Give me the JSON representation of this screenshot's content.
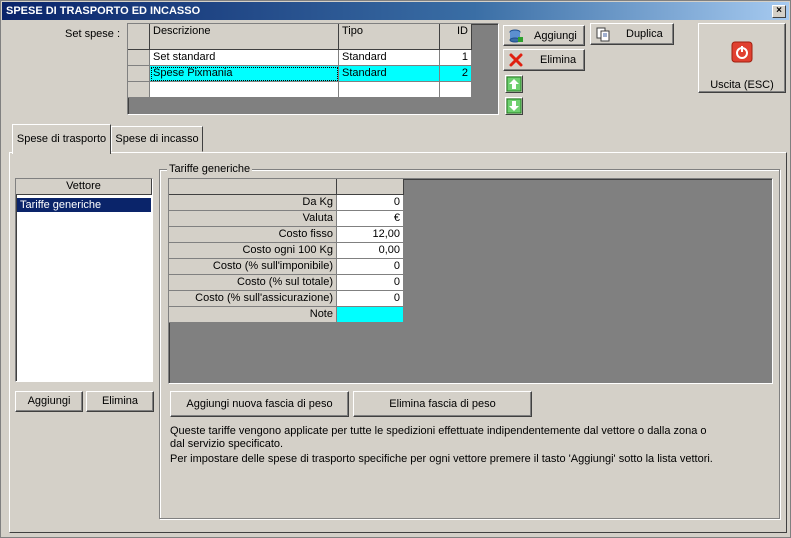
{
  "window": {
    "title": "SPESE DI TRASPORTO ED INCASSO",
    "close_glyph": "×"
  },
  "set_spese": {
    "label": "Set spese :",
    "columns": [
      "Descrizione",
      "Tipo",
      "ID"
    ],
    "rows": [
      {
        "descrizione": "Set standard",
        "tipo": "Standard",
        "id": "1"
      },
      {
        "descrizione": "Spese Pixmania",
        "tipo": "Standard",
        "id": "2"
      }
    ]
  },
  "toolbar": {
    "aggiungi": "Aggiungi",
    "elimina": "Elimina",
    "duplica": "Duplica",
    "uscita": "Uscita (ESC)"
  },
  "tabs": [
    {
      "label": "Spese di trasporto"
    },
    {
      "label": "Spese di incasso"
    }
  ],
  "vettore": {
    "header": "Vettore",
    "items": [
      "Tariffe generiche"
    ],
    "aggiungi": "Aggiungi",
    "elimina": "Elimina"
  },
  "tariffe": {
    "group_title": "Tariffe generiche",
    "rows": [
      {
        "label": "Da Kg",
        "value": "0"
      },
      {
        "label": "Valuta",
        "value": "€"
      },
      {
        "label": "Costo fisso",
        "value": "12,00"
      },
      {
        "label": "Costo ogni 100 Kg",
        "value": "0,00"
      },
      {
        "label": "Costo (% sull'imponibile)",
        "value": "0"
      },
      {
        "label": "Costo (% sul totale)",
        "value": "0"
      },
      {
        "label": "Costo (% sull'assicurazione)",
        "value": "0"
      },
      {
        "label": "Note",
        "value": ""
      }
    ],
    "add_band": "Aggiungi nuova fascia di peso",
    "remove_band": "Elimina fascia di peso",
    "info_line1": "Queste tariffe vengono applicate per tutte le spedizioni effettuate indipendentemente dal vettore o dalla zona o",
    "info_line2": "dal servizio specificato.",
    "info_line3": "Per impostare delle spese di trasporto specifiche per ogni vettore premere il tasto 'Aggiungi' sotto la lista vettori."
  },
  "colors": {
    "selection": "#00ffff",
    "listSelect": "#0a246a",
    "gridBg": "#808080"
  }
}
